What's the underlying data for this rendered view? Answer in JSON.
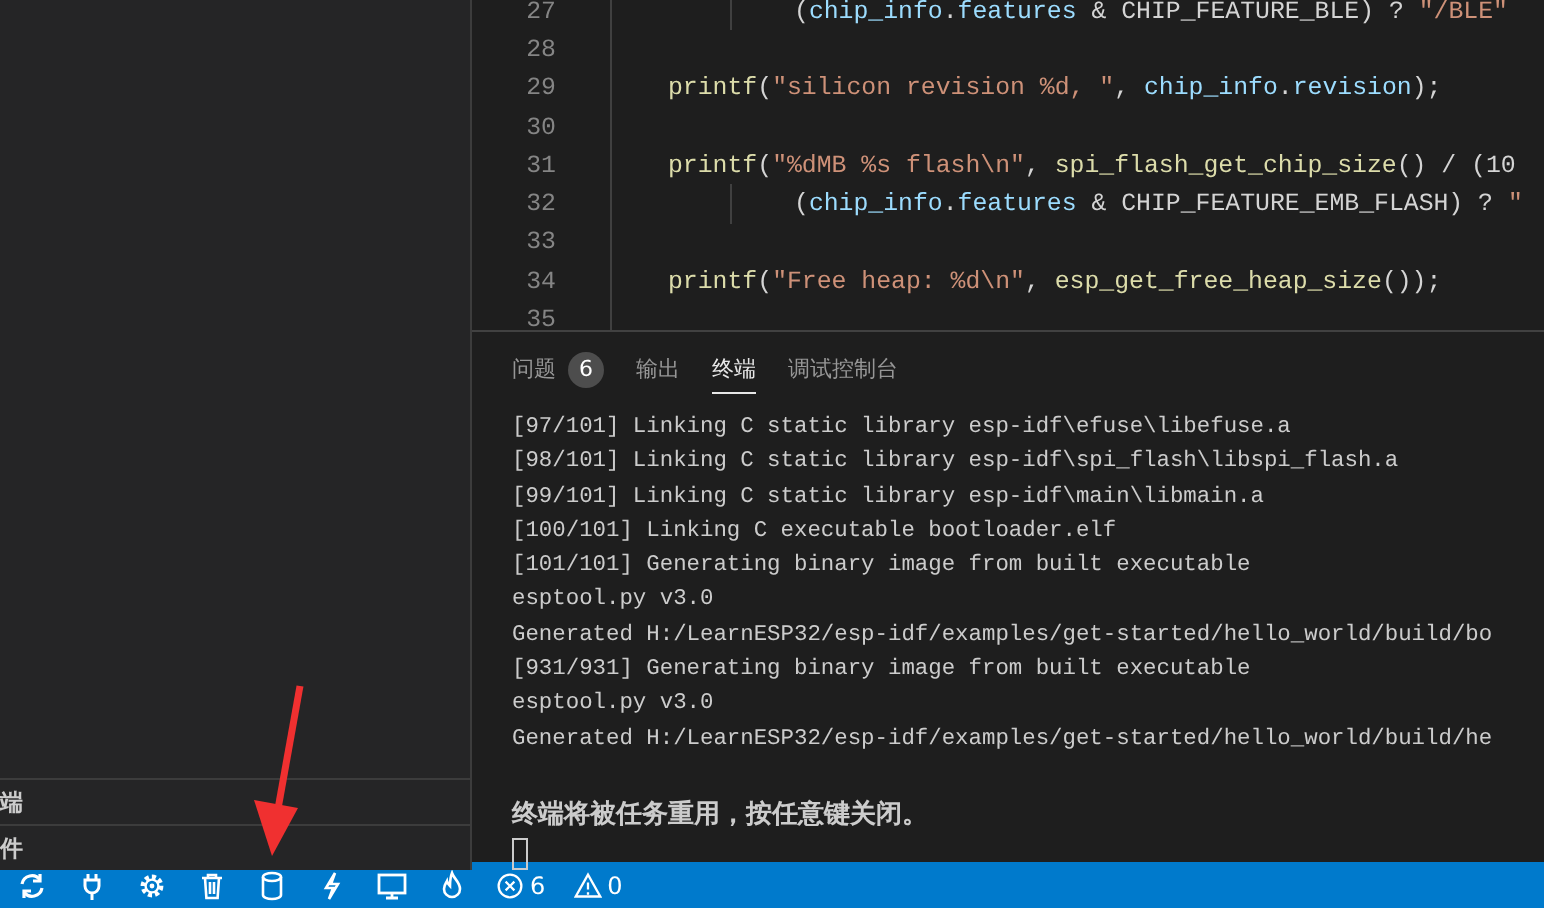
{
  "sidebar": {
    "sections": [
      "端",
      "件"
    ]
  },
  "editor": {
    "lines": [
      {
        "number": "27",
        "kind": "continuation",
        "tokens": [
          {
            "kind": "plain",
            "text": "("
          },
          {
            "kind": "var",
            "text": "chip_info"
          },
          {
            "kind": "plain",
            "text": "."
          },
          {
            "kind": "var",
            "text": "features"
          },
          {
            "kind": "plain",
            "text": " & CHIP_FEATURE_BLE) ? "
          },
          {
            "kind": "str",
            "text": "\"/BLE\""
          }
        ]
      },
      {
        "number": "28",
        "kind": "blank"
      },
      {
        "number": "29",
        "kind": "statement",
        "tokens": [
          {
            "kind": "fn",
            "text": "printf"
          },
          {
            "kind": "plain",
            "text": "("
          },
          {
            "kind": "str",
            "text": "\"silicon revision %d, \""
          },
          {
            "kind": "plain",
            "text": ", "
          },
          {
            "kind": "var",
            "text": "chip_info"
          },
          {
            "kind": "plain",
            "text": "."
          },
          {
            "kind": "var",
            "text": "revision"
          },
          {
            "kind": "plain",
            "text": ");"
          }
        ]
      },
      {
        "number": "30",
        "kind": "blank"
      },
      {
        "number": "31",
        "kind": "statement",
        "tokens": [
          {
            "kind": "fn",
            "text": "printf"
          },
          {
            "kind": "plain",
            "text": "("
          },
          {
            "kind": "str",
            "text": "\"%dMB %s flash\\n\""
          },
          {
            "kind": "plain",
            "text": ", "
          },
          {
            "kind": "fn",
            "text": "spi_flash_get_chip_size"
          },
          {
            "kind": "plain",
            "text": "() / (10"
          }
        ]
      },
      {
        "number": "32",
        "kind": "continuation",
        "tokens": [
          {
            "kind": "plain",
            "text": "("
          },
          {
            "kind": "var",
            "text": "chip_info"
          },
          {
            "kind": "plain",
            "text": "."
          },
          {
            "kind": "var",
            "text": "features"
          },
          {
            "kind": "plain",
            "text": " & CHIP_FEATURE_EMB_FLASH) ? "
          },
          {
            "kind": "str",
            "text": "\""
          }
        ]
      },
      {
        "number": "33",
        "kind": "blank"
      },
      {
        "number": "34",
        "kind": "statement",
        "tokens": [
          {
            "kind": "fn",
            "text": "printf"
          },
          {
            "kind": "plain",
            "text": "("
          },
          {
            "kind": "str",
            "text": "\"Free heap: %d\\n\""
          },
          {
            "kind": "plain",
            "text": ", "
          },
          {
            "kind": "fn",
            "text": "esp_get_free_heap_size"
          },
          {
            "kind": "plain",
            "text": "());"
          }
        ]
      },
      {
        "number": "35",
        "kind": "blank"
      }
    ]
  },
  "panel": {
    "tabs": [
      {
        "label": "问题",
        "badge": "6",
        "selected": false
      },
      {
        "label": "输出",
        "selected": false
      },
      {
        "label": "终端",
        "selected": true
      },
      {
        "label": "调试控制台",
        "selected": false
      }
    ],
    "terminal": [
      {
        "kind": "output",
        "text": "[97/101] Linking C static library esp-idf\\efuse\\libefuse.a"
      },
      {
        "kind": "output",
        "text": "[98/101] Linking C static library esp-idf\\spi_flash\\libspi_flash.a"
      },
      {
        "kind": "output",
        "text": "[99/101] Linking C static library esp-idf\\main\\libmain.a"
      },
      {
        "kind": "output",
        "text": "[100/101] Linking C executable bootloader.elf"
      },
      {
        "kind": "output",
        "text": "[101/101] Generating binary image from built executable"
      },
      {
        "kind": "output",
        "text": "esptool.py v3.0"
      },
      {
        "kind": "output",
        "text": "Generated H:/LearnESP32/esp-idf/examples/get-started/hello_world/build/bo"
      },
      {
        "kind": "output",
        "text": "[931/931] Generating binary image from built executable"
      },
      {
        "kind": "output",
        "text": "esptool.py v3.0"
      },
      {
        "kind": "output",
        "text": "Generated H:/LearnESP32/esp-idf/examples/get-started/hello_world/build/he"
      },
      {
        "kind": "blank"
      },
      {
        "kind": "notice",
        "text": "终端将被任务重用，按任意键关闭。"
      },
      {
        "kind": "cursor"
      }
    ]
  },
  "status_bar": {
    "errors": "6",
    "warnings": "0"
  }
}
